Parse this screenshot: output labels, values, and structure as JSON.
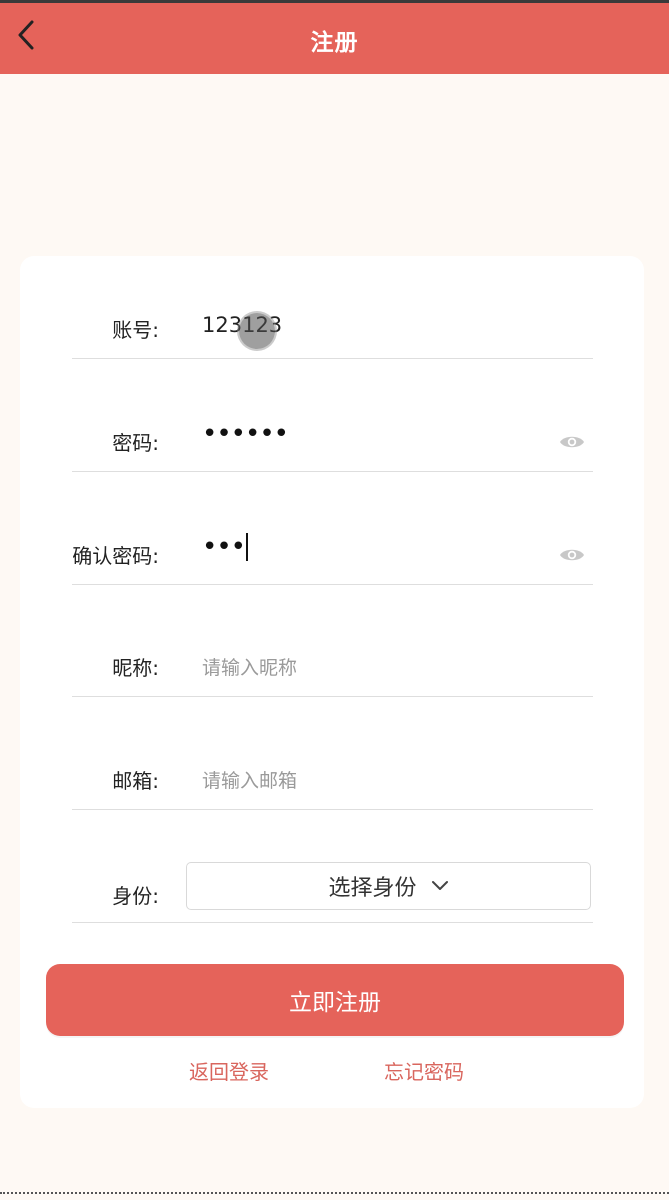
{
  "header": {
    "title": "注册",
    "back_icon": "chevron-left-icon"
  },
  "colors": {
    "brand": "#e5635a",
    "page_background": "#fef9f4",
    "link": "#d9665e"
  },
  "form": {
    "account": {
      "label": "账号:",
      "value": "123123"
    },
    "password": {
      "label": "密码:",
      "value": "••••••",
      "toggle_icon": "eye-icon"
    },
    "confirm_password": {
      "label": "确认密码:",
      "value": "•••",
      "toggle_icon": "eye-icon"
    },
    "nickname": {
      "label": "昵称:",
      "placeholder": "请输入昵称"
    },
    "email": {
      "label": "邮箱:",
      "placeholder": "请输入邮箱"
    },
    "identity": {
      "label": "身份:",
      "selected": "选择身份",
      "dropdown_icon": "chevron-down-icon"
    }
  },
  "actions": {
    "submit_label": "立即注册",
    "back_to_login": "返回登录",
    "forgot_password": "忘记密码"
  }
}
